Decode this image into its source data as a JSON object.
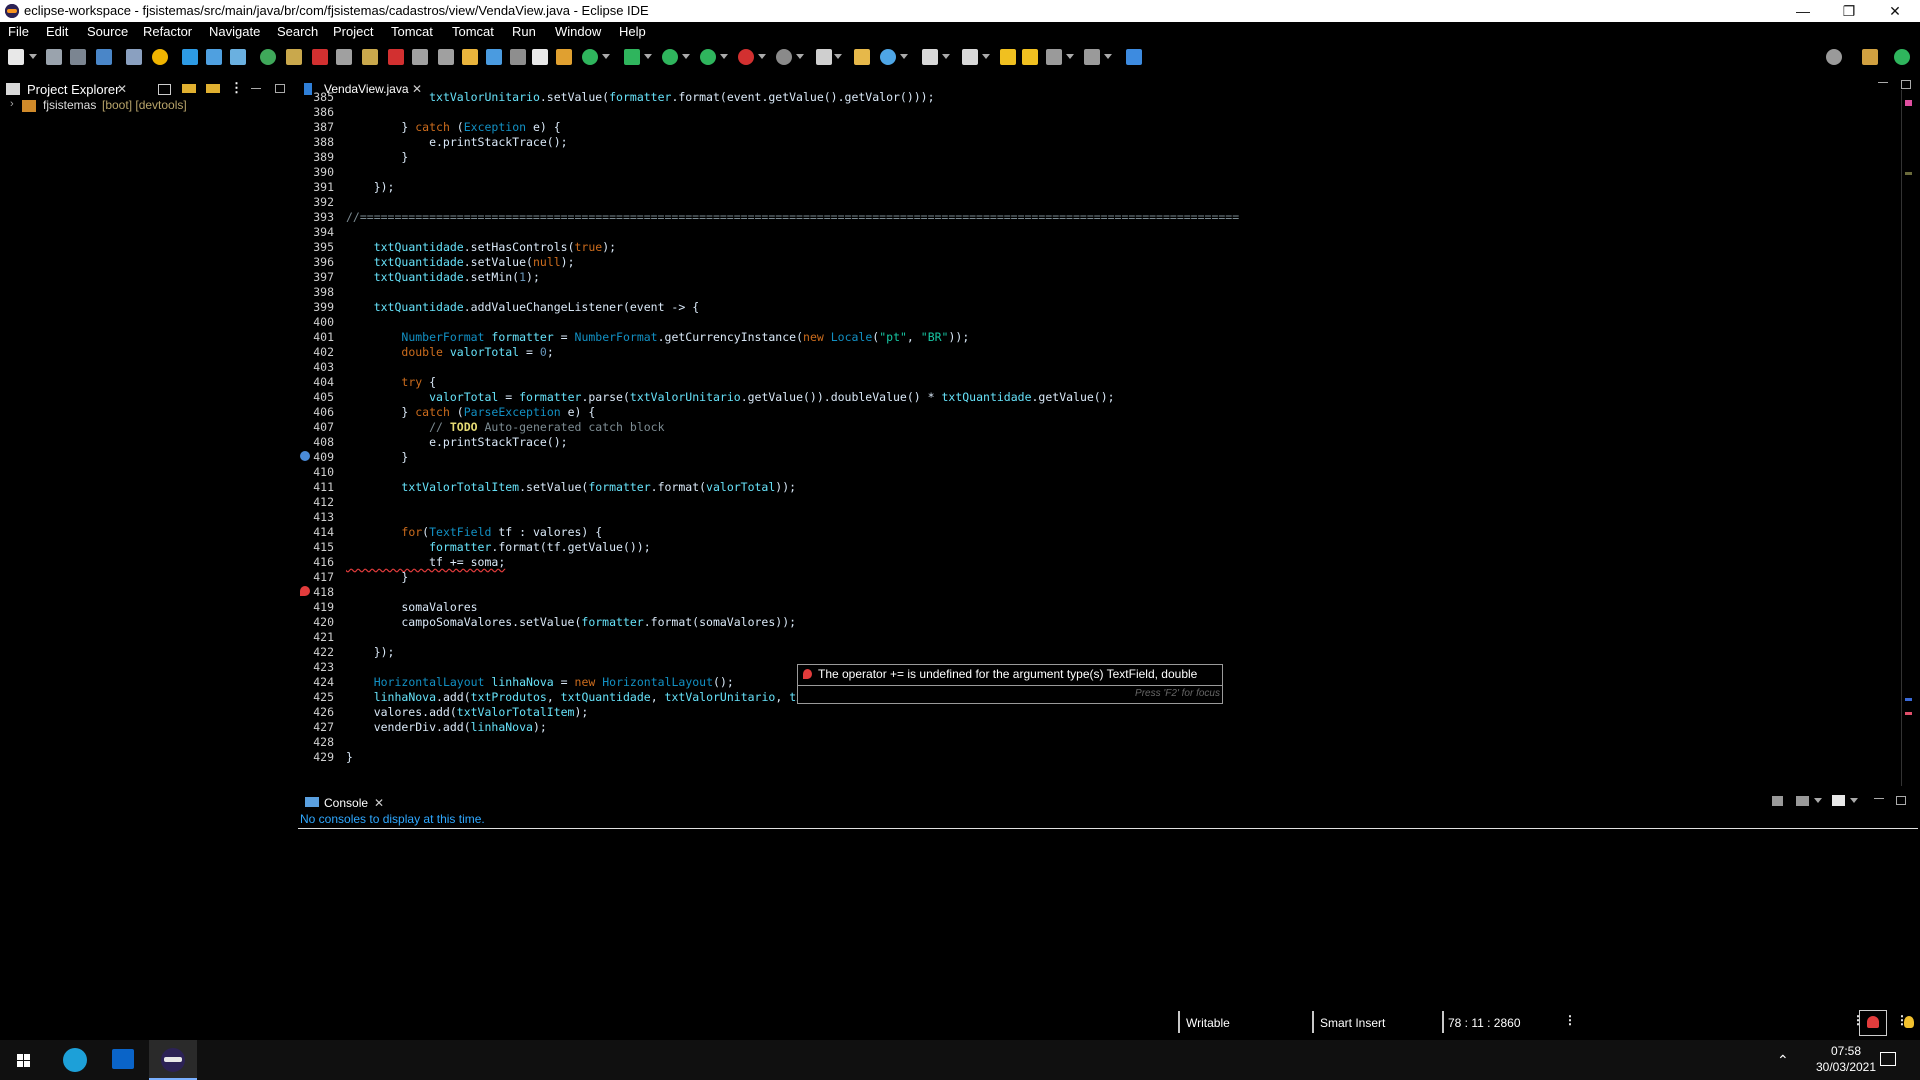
{
  "window": {
    "title": "eclipse-workspace - fjsistemas/src/main/java/br/com/fjsistemas/cadastros/view/VendaView.java - Eclipse IDE",
    "buttons": [
      "—",
      "❐",
      "✕"
    ]
  },
  "menu": [
    "File",
    "Edit",
    "Source",
    "Refactor",
    "Navigate",
    "Search",
    "Project",
    "Tomcat",
    "Tomcat",
    "Run",
    "Window",
    "Help"
  ],
  "project_explorer": {
    "tab_label": "Project Explorer",
    "project_name": "fjsistemas",
    "project_decoration": "[boot] [devtools]"
  },
  "editor": {
    "tab_label": "VendaView.java",
    "lines": [
      {
        "n": "385",
        "code": "            txtValorUnitario.setValue(formatter.format(event.getValue().getValor()));"
      },
      {
        "n": "386",
        "code": ""
      },
      {
        "n": "387",
        "code": "        } catch (Exception e) {"
      },
      {
        "n": "388",
        "code": "            e.printStackTrace();"
      },
      {
        "n": "389",
        "code": "        }"
      },
      {
        "n": "390",
        "code": ""
      },
      {
        "n": "391",
        "code": "    });"
      },
      {
        "n": "392",
        "code": ""
      },
      {
        "n": "393",
        "code": "//==============================================================================================================================="
      },
      {
        "n": "394",
        "code": ""
      },
      {
        "n": "395",
        "code": "    txtQuantidade.setHasControls(true);"
      },
      {
        "n": "396",
        "code": "    txtQuantidade.setValue(null);"
      },
      {
        "n": "397",
        "code": "    txtQuantidade.setMin(1);"
      },
      {
        "n": "398",
        "code": ""
      },
      {
        "n": "399",
        "code": "    txtQuantidade.addValueChangeListener(event -> {"
      },
      {
        "n": "400",
        "code": ""
      },
      {
        "n": "401",
        "code": "        NumberFormat formatter = NumberFormat.getCurrencyInstance(new Locale(\"pt\", \"BR\"));"
      },
      {
        "n": "402",
        "code": "        double valorTotal = 0;"
      },
      {
        "n": "403",
        "code": ""
      },
      {
        "n": "404",
        "code": "        try {"
      },
      {
        "n": "405",
        "code": "            valorTotal = formatter.parse(txtValorUnitario.getValue()).doubleValue() * txtQuantidade.getValue();"
      },
      {
        "n": "406",
        "code": "        } catch (ParseException e) {"
      },
      {
        "n": "407",
        "code": "            // TODO Auto-generated catch block"
      },
      {
        "n": "408",
        "code": "            e.printStackTrace();"
      },
      {
        "n": "409",
        "code": "        }"
      },
      {
        "n": "410",
        "code": ""
      },
      {
        "n": "411",
        "code": "        txtValorTotalItem.setValue(formatter.format(valorTotal));"
      },
      {
        "n": "412",
        "code": ""
      },
      {
        "n": "413",
        "code": ""
      },
      {
        "n": "414",
        "code": "        for(TextField tf : valores) {"
      },
      {
        "n": "415",
        "code": "            formatter.format(tf.getValue());"
      },
      {
        "n": "416",
        "code": "            tf += soma;"
      },
      {
        "n": "417",
        "code": "        }"
      },
      {
        "n": "418",
        "code": ""
      },
      {
        "n": "419",
        "code": "        somaValores"
      },
      {
        "n": "420",
        "code": "        campoSomaValores.setValue(formatter.format(somaValores));"
      },
      {
        "n": "421",
        "code": ""
      },
      {
        "n": "422",
        "code": "    });"
      },
      {
        "n": "423",
        "code": ""
      },
      {
        "n": "424",
        "code": "    HorizontalLayout linhaNova = new HorizontalLayout();"
      },
      {
        "n": "425",
        "code": "    linhaNova.add(txtProdutos, txtQuantidade, txtValorUnitario, txtValorTotalItem);"
      },
      {
        "n": "426",
        "code": "    valores.add(txtValorTotalItem);"
      },
      {
        "n": "427",
        "code": "    venderDiv.add(linhaNova);"
      },
      {
        "n": "428",
        "code": ""
      },
      {
        "n": "429",
        "code": "}"
      }
    ],
    "tooltip": {
      "message": "The operator += is undefined for the argument type(s) TextField, double",
      "hint": "Press 'F2' for focus"
    }
  },
  "console": {
    "tab_label": "Console",
    "message": "No consoles to display at this time."
  },
  "statusbar": {
    "writable": "Writable",
    "insert_mode": "Smart Insert",
    "position": "78 : 11 : 2860"
  },
  "taskbar": {
    "time": "07:58",
    "date": "30/03/2021"
  },
  "colors": {
    "keyword": "#cc6c1d",
    "field": "#66e1f8",
    "type": "#1290c3",
    "string": "#17c6a3",
    "comment": "#7d8c93",
    "error": "#e23c3c"
  }
}
